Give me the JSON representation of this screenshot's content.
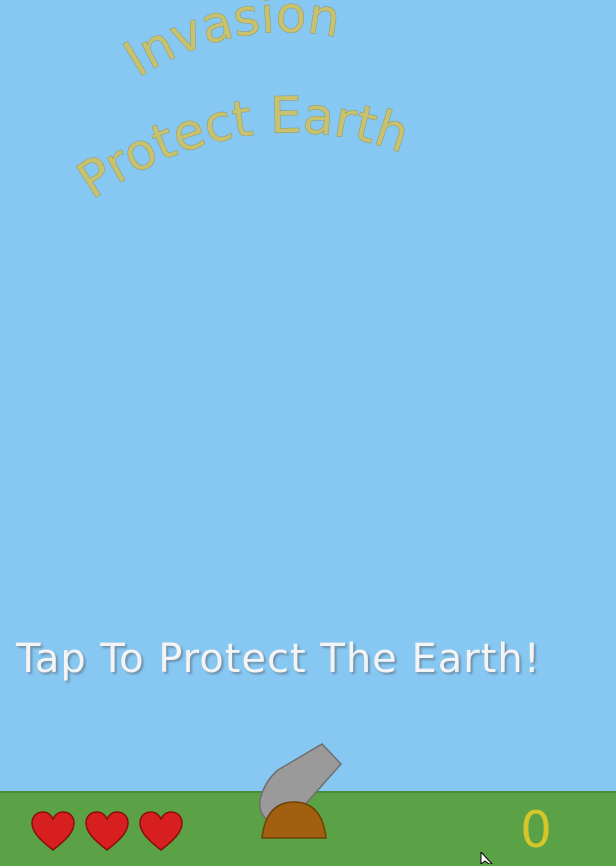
{
  "title": {
    "line1": "Invasion",
    "line2": "Protect Earth"
  },
  "prompt": "Tap To Protect The Earth!",
  "hud": {
    "lives": 3,
    "score": "0"
  },
  "colors": {
    "sky": "#87c8f3",
    "ground": "#5aa245",
    "title_text": "#c8c16d",
    "heart": "#d81f1f",
    "score": "#d6c62b",
    "cannon_barrel": "#9a9a9a",
    "cannon_base": "#a0600f"
  },
  "icons": {
    "life": "heart-icon",
    "player": "cannon-icon",
    "pointer": "mouse-cursor-icon"
  }
}
